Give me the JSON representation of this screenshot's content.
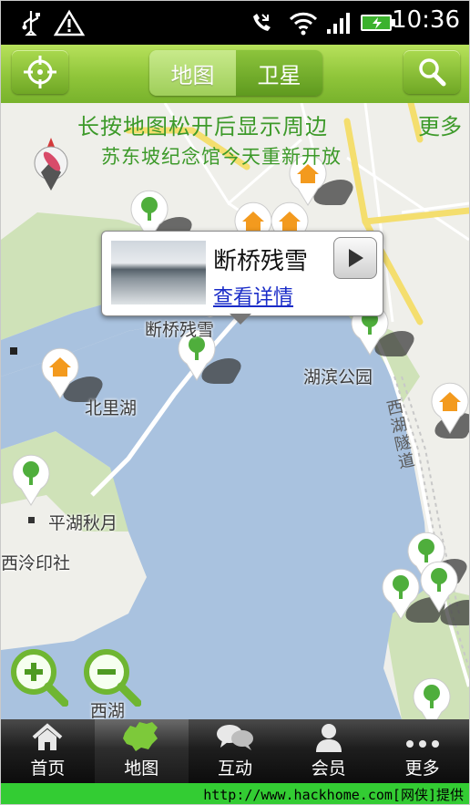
{
  "status_bar": {
    "time": "10:36",
    "icons": [
      "usb-icon",
      "warning-icon",
      "missed-call-icon",
      "wifi-icon",
      "signal-icon",
      "battery-icon"
    ]
  },
  "toolbar": {
    "locate_icon": "crosshair-icon",
    "map_type": {
      "options": [
        "地图",
        "卫星"
      ],
      "selected": "地图"
    },
    "search_icon": "search-icon"
  },
  "map": {
    "hint": "长按地图松开后显示周边",
    "more": "更多",
    "notice": "苏东坡纪念馆今天重新开放",
    "labels": {
      "duanqiao": "断桥残雪",
      "beilihu": "北里湖",
      "hubin": "湖滨公园",
      "xihu_road": "西湖隧道",
      "pinghu": "平湖秋月",
      "xiling": "西泠印社",
      "xihu": "西湖"
    },
    "popup": {
      "title": "断桥残雪",
      "link": "查看详情",
      "play_icon": "play-icon"
    },
    "zoom_in_icon": "zoom-in-icon",
    "zoom_out_icon": "zoom-out-icon",
    "compass_icon": "compass-icon",
    "colors": {
      "water": "#a8c1de",
      "park": "#cfe2b8",
      "road": "#f6e27d",
      "green_text": "#3d9a2a"
    }
  },
  "bottom_nav": {
    "items": [
      {
        "label": "首页",
        "icon": "home-icon"
      },
      {
        "label": "地图",
        "icon": "china-map-icon"
      },
      {
        "label": "互动",
        "icon": "chat-icon"
      },
      {
        "label": "会员",
        "icon": "user-icon"
      },
      {
        "label": "更多",
        "icon": "more-icon"
      }
    ],
    "active": "地图"
  },
  "footer": {
    "text": "http://www.hackhome.com[网侠]提供"
  }
}
